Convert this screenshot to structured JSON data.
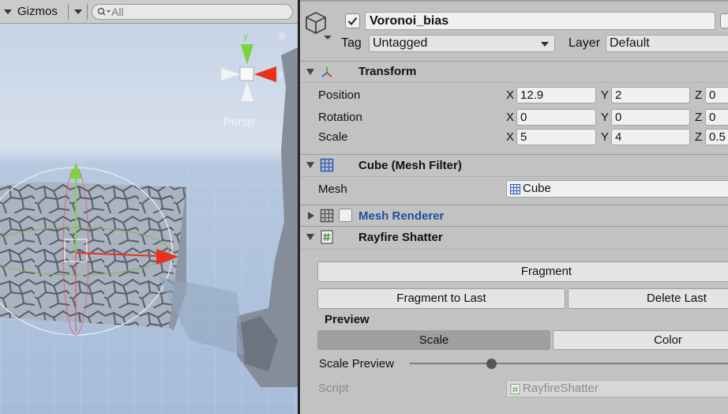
{
  "scene": {
    "gizmos_label": "Gizmos",
    "search_placeholder": "All",
    "persp_label": "Persp",
    "axis_labels": {
      "y": "y",
      "x": "x"
    }
  },
  "inspector": {
    "object_name": "Voronoi_bias",
    "active": true,
    "tag_label": "Tag",
    "tag_value": "Untagged",
    "layer_label": "Layer",
    "layer_value": "Default",
    "transform": {
      "title": "Transform",
      "position_label": "Position",
      "rotation_label": "Rotation",
      "scale_label": "Scale",
      "axis_x": "X",
      "axis_y": "Y",
      "axis_z": "Z",
      "position": {
        "x": "12.9",
        "y": "2",
        "z": "0"
      },
      "rotation": {
        "x": "0",
        "y": "0",
        "z": "0"
      },
      "scale": {
        "x": "5",
        "y": "4",
        "z": "0.5"
      }
    },
    "mesh_filter": {
      "title": "Cube (Mesh Filter)",
      "mesh_label": "Mesh",
      "mesh_value": "Cube"
    },
    "mesh_renderer": {
      "title": "Mesh Renderer",
      "enabled": false
    },
    "rayfire": {
      "title": "Rayfire Shatter",
      "fragment_button": "Fragment",
      "fragment_last_button": "Fragment to Last",
      "delete_last_button": "Delete Last",
      "preview_label": "Preview",
      "scale_tab": "Scale",
      "color_tab": "Color",
      "scale_preview_label": "Scale Preview",
      "scale_preview_value": 0.25,
      "script_label": "Script",
      "script_value": "RayfireShatter"
    }
  },
  "colors": {
    "sky_top": "#c9d7ea",
    "ground": "#a9bfdc",
    "x_axis": "#e8321a",
    "y_axis": "#7dd43a",
    "blue_title": "#1c4f9c"
  }
}
